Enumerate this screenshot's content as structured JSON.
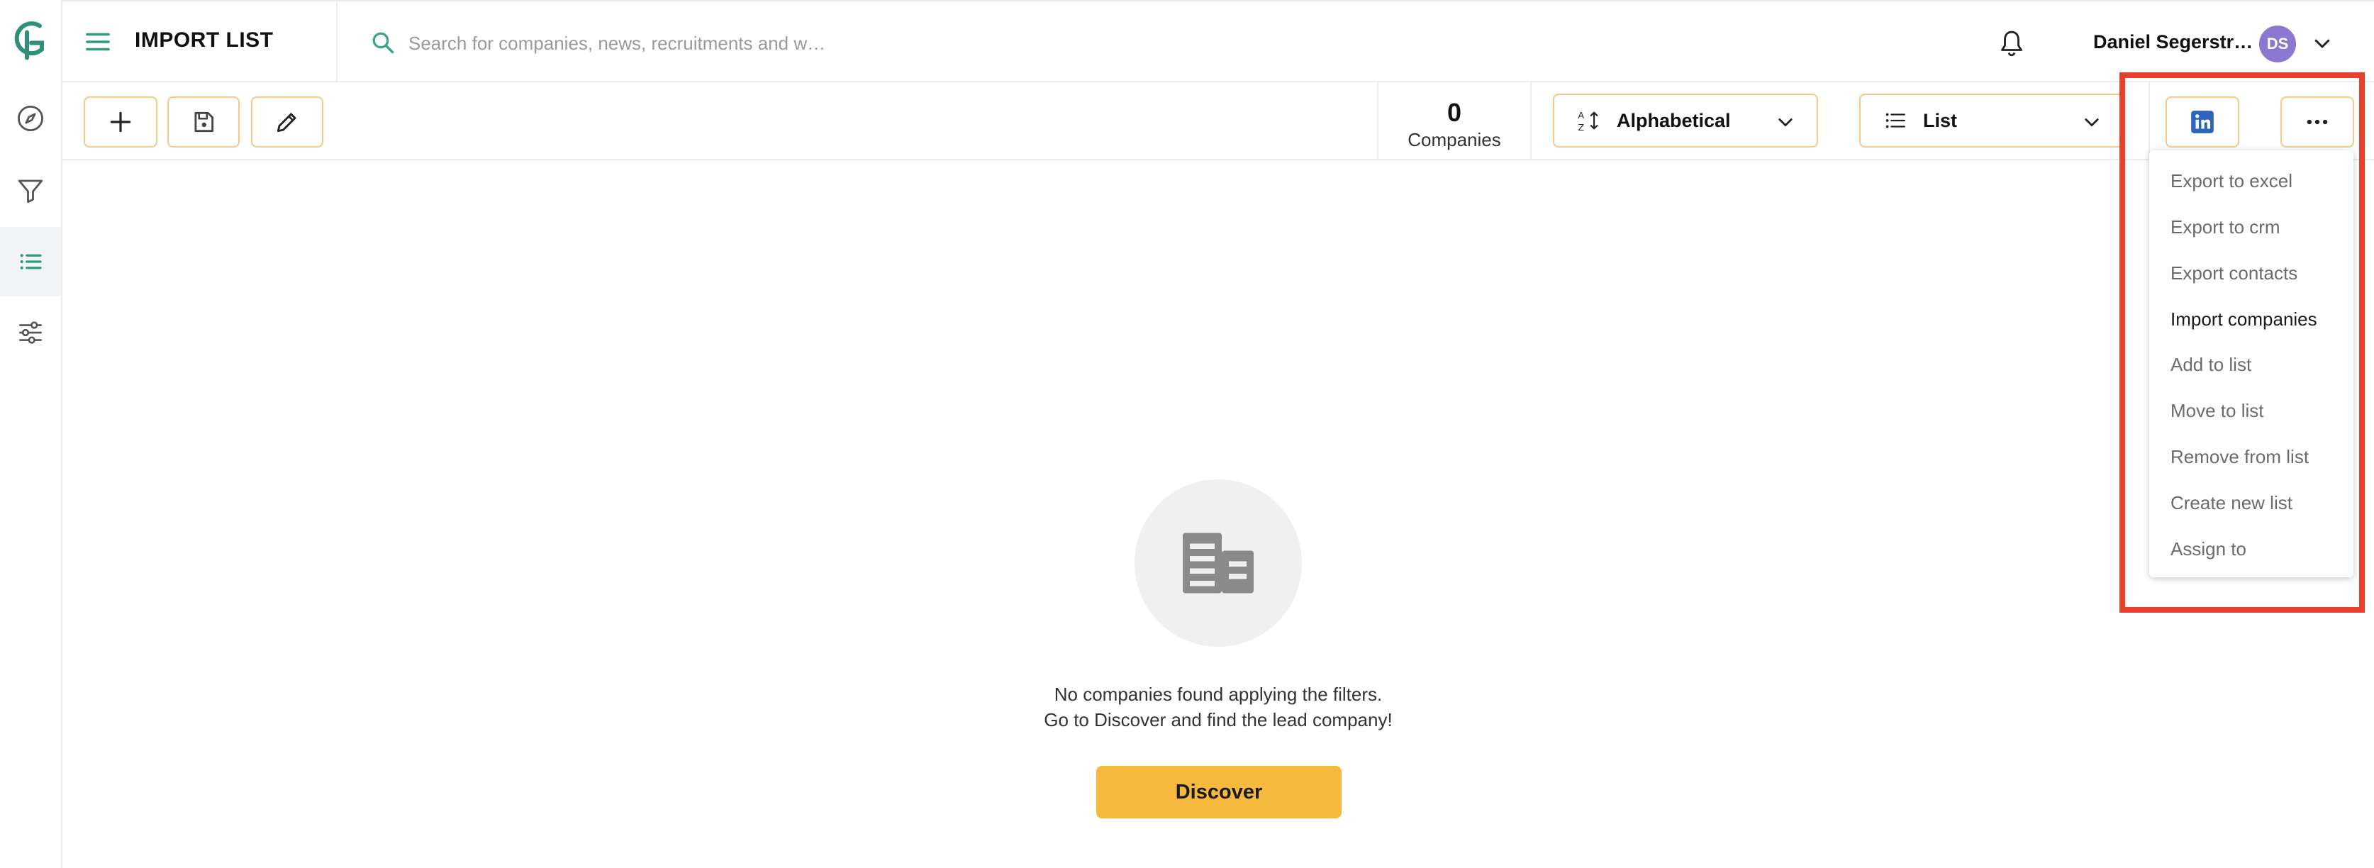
{
  "header": {
    "title": "IMPORT LIST",
    "search_placeholder": "Search for companies, news, recruitments and w…",
    "user_name": "Daniel Segerstr…",
    "user_initials": "DS"
  },
  "sidebar": {
    "items": [
      {
        "icon": "compass-icon"
      },
      {
        "icon": "filter-icon"
      },
      {
        "icon": "list-icon",
        "active": true
      },
      {
        "icon": "sliders-icon"
      }
    ]
  },
  "toolbar": {
    "company_count": "0",
    "company_count_label": "Companies",
    "sort_label": "Alphabetical",
    "view_label": "List"
  },
  "more_menu": {
    "items": [
      "Export to excel",
      "Export to crm",
      "Export contacts",
      "Import companies",
      "Add to list",
      "Move to list",
      "Remove from list",
      "Create new list",
      "Assign to"
    ],
    "hovered_item": "Import companies"
  },
  "empty_state": {
    "line1": "No companies found applying the filters.",
    "line2": "Go to Discover and find the lead company!",
    "button_label": "Discover"
  },
  "colors": {
    "accent_teal": "#3aa68a",
    "button_border": "#f4c986",
    "discover_button": "#f5b93e",
    "avatar": "#8c78d0",
    "linkedin": "#2d64bc",
    "highlight_frame": "#e8412b"
  }
}
